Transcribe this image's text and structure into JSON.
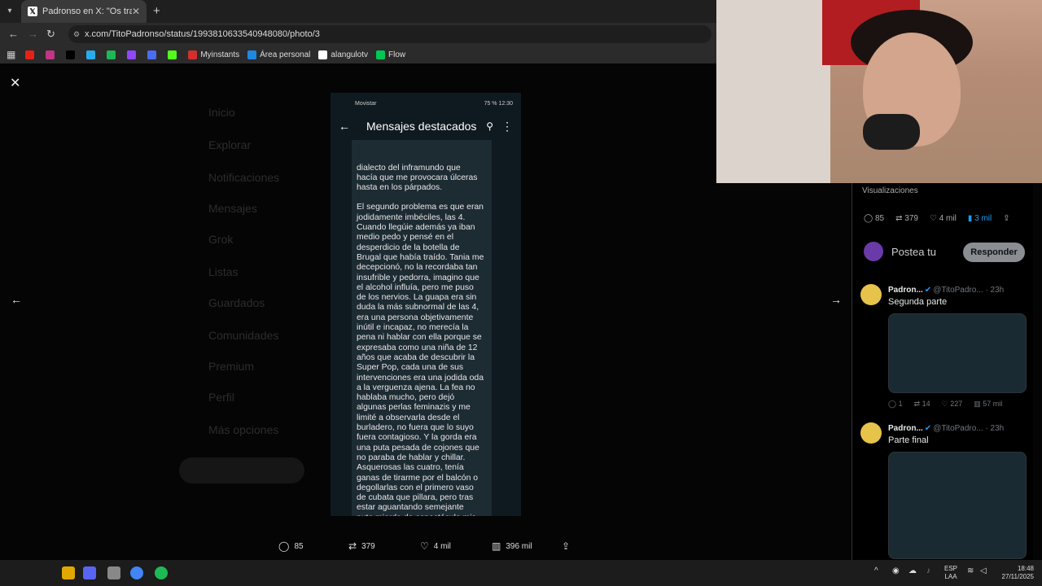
{
  "browser": {
    "tab_title": "Padronso en X: \"Os traigo una",
    "url": "x.com/TitoPadronso/status/1993810633540948080/photo/3",
    "bookmarks": [
      {
        "label": "",
        "color": "#e62117"
      },
      {
        "label": "",
        "color": "#c13584"
      },
      {
        "label": "",
        "color": "#000000"
      },
      {
        "label": "",
        "color": "#2aabee"
      },
      {
        "label": "",
        "color": "#1db954"
      },
      {
        "label": "",
        "color": "#9146ff"
      },
      {
        "label": "",
        "color": "#4a6cf7"
      },
      {
        "label": "",
        "color": "#53fc18"
      },
      {
        "label": "Myinstants",
        "color": "#d32f2f"
      },
      {
        "label": "Área personal",
        "color": "#1e88e5"
      },
      {
        "label": "alangulotv",
        "color": "#ffffff"
      },
      {
        "label": "Flow",
        "color": "#00c853"
      }
    ]
  },
  "phone": {
    "carrier": "Movistar",
    "status_right": "75 %  12:30",
    "title": "Mensajes destacados",
    "paragraphs": [
      "dialecto del inframundo que\nhacía que me provocara úlceras\nhasta en los párpados.",
      "El segundo problema es que eran\njodidamente imbéciles, las 4.\nCuando llegúie además ya iban\nmedio pedo y pensé en el\ndesperdicio de la botella de\nBrugal que había traído. Tania me\ndecepcionó, no la recordaba tan\ninsufrible y pedorra, imagino que\nel alcohol influía, pero me puso\nde los nervios. La guapa era sin\nduda la más subnormal de las 4,\nera una persona objetivamente\ninútil e incapaz, no merecía la\npena ni hablar con ella porque se\nexpresaba como una niña de 12\naños que acaba de descubrir la\nSuper Pop, cada una de sus\nintervenciones era una jodida oda\na la verguenza ajena. La fea no\nhablaba mucho, pero dejó\nalgunas perlas feminazis y me\nlimité a observarla desde el\nburladero, no fuera que lo suyo\nfuera contagioso. Y la gorda era\nuna puta pesada de cojones que\nno paraba de hablar y chillar.\nAsquerosas las cuatro, tenía\nganas de tirarme por el balcón o\ndegollarlas con el primero vaso\nde cubata que pillara, pero tras\nestar aguantando semejante\nputa mierda de espectáculo mis\nganas de meterla en caliente iban"
    ]
  },
  "photo_actions": {
    "replies": "85",
    "reposts": "379",
    "likes": "4 mil",
    "views": "396 mil"
  },
  "right_panel": {
    "views_label": "Visualizaciones",
    "stats": {
      "replies": "85",
      "reposts": "379",
      "likes": "4 mil",
      "bookmarks": "3 mil"
    },
    "reply_placeholder": "Postea tu",
    "reply_button": "Responder",
    "tweets": [
      {
        "name": "Padron...",
        "handle": "@TitoPadro...",
        "time": "· 23h",
        "text": "Segunda parte",
        "replies": "1",
        "reposts": "14",
        "likes": "227",
        "views": "57 mil"
      },
      {
        "name": "Padron...",
        "handle": "@TitoPadro...",
        "time": "· 23h",
        "text": "Parte final"
      }
    ]
  },
  "taskbar": {
    "lang1": "ESP",
    "lang2": "LAA",
    "time": "18:48",
    "date": "27/11/2025"
  }
}
